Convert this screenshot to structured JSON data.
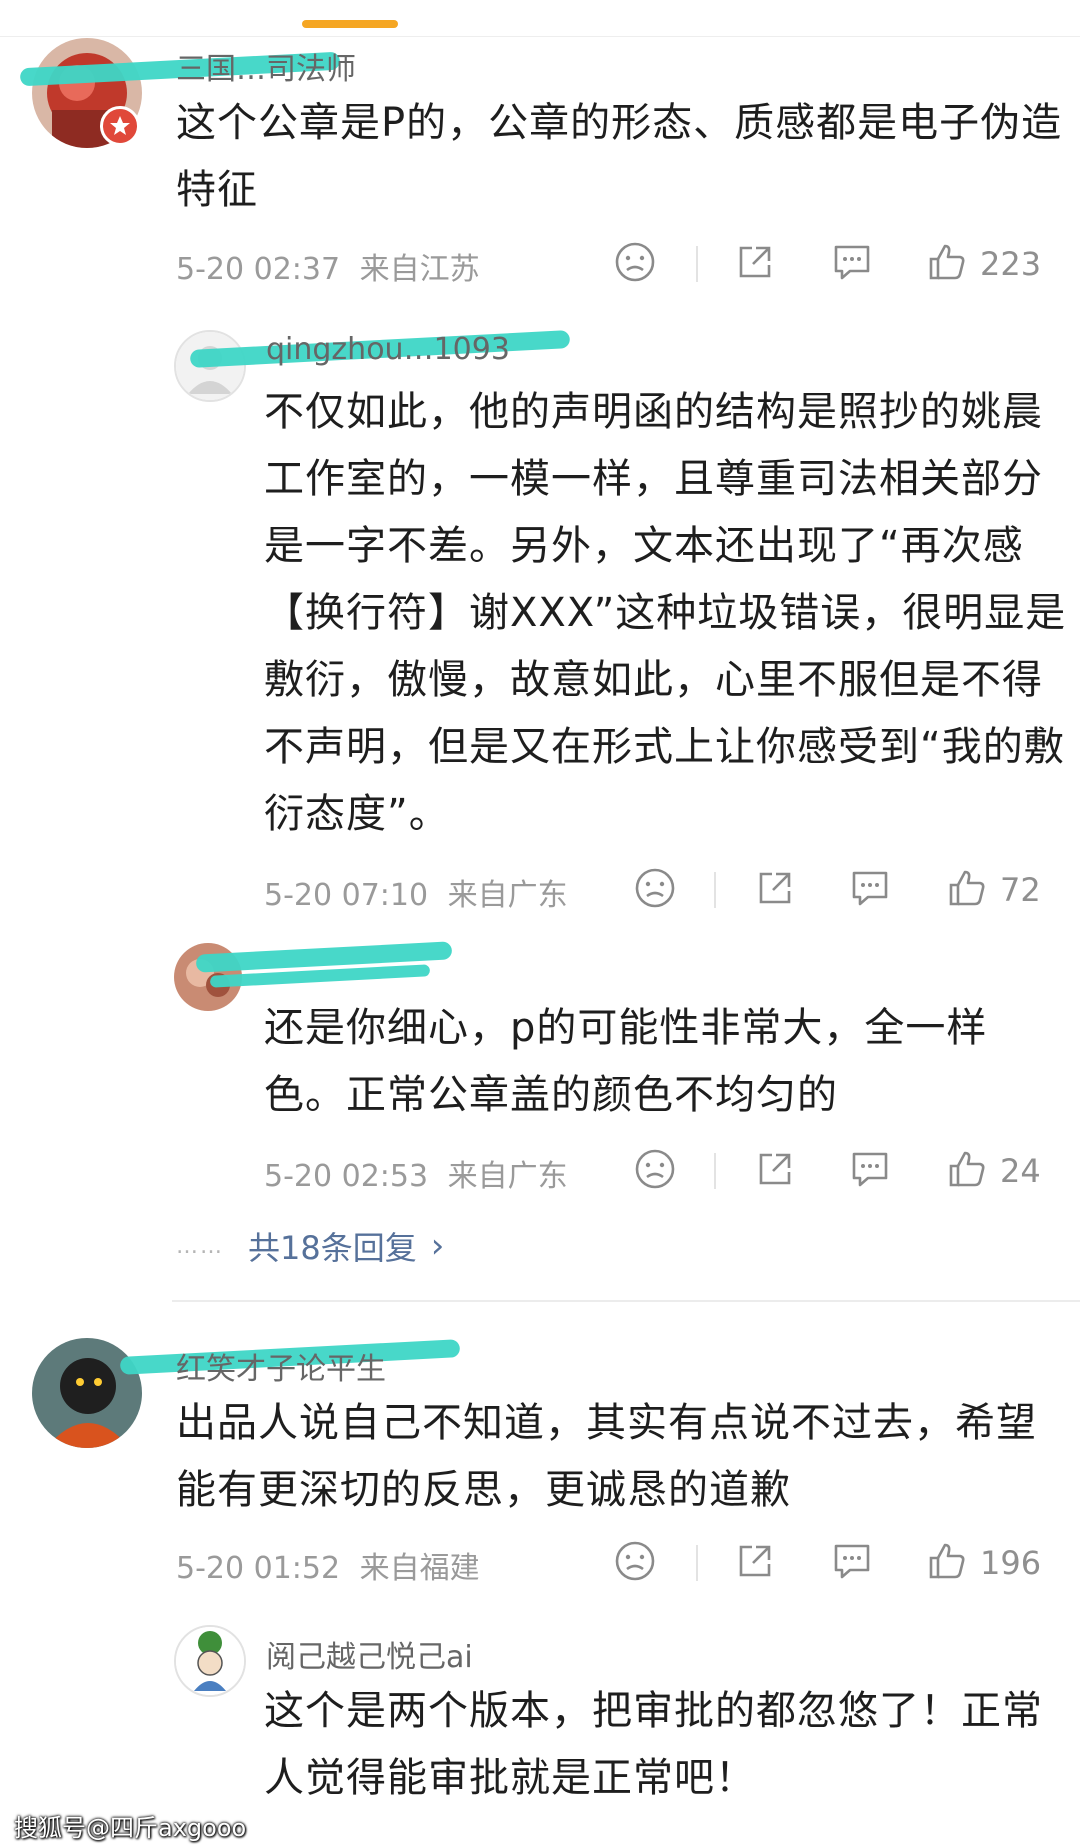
{
  "comments": [
    {
      "username": "三国…司法师",
      "text_lines": [
        "这个公章是P的，公章的形态、质感都是电子伪造",
        "特征"
      ],
      "time": "5-20 02:37",
      "location": "来自江苏",
      "likes": "223"
    },
    {
      "username": "qingzhou…1093",
      "text_lines": [
        "不仅如此，他的声明函的结构是照抄的姚晨",
        "工作室的，一模一样，且尊重司法相关部分",
        "是一字不差。另外，文本还出现了“再次感",
        "【换行符】谢XXX”这种垃圾错误，很明显是",
        "敷衍，傲慢，故意如此，心里不服但是不得",
        "不声明，但是又在形式上让你感受到“我的敷",
        "衍态度”。"
      ],
      "time": "5-20 07:10",
      "location": "来自广东",
      "likes": "72"
    },
    {
      "username": "",
      "text_lines": [
        "还是你细心，p的可能性非常大，全一样",
        "色。正常公章盖的颜色不均匀的"
      ],
      "time": "5-20 02:53",
      "location": "来自广东",
      "likes": "24"
    },
    {
      "username": "红笑才子论平生",
      "text_lines": [
        "出品人说自己不知道，其实有点说不过去，希望",
        "能有更深切的反思，更诚恳的道歉"
      ],
      "time": "5-20 01:52",
      "location": "来自福建",
      "likes": "196"
    },
    {
      "username": "阅己越己悦己ai",
      "text_lines": [
        "这个是两个版本，把审批的都忽悠了！正常",
        "人觉得能审批就是正常吧！"
      ]
    }
  ],
  "more_replies": "共18条回复",
  "watermark": "搜狐号@四斤axgooo",
  "colors": {
    "accent": "#f5a623",
    "link": "#56719a",
    "scribble": "#3ed6c6",
    "meta": "#9a9a9a"
  },
  "icons": [
    "dislike-icon",
    "share-icon",
    "comment-icon",
    "like-icon",
    "chevron-right-icon"
  ]
}
